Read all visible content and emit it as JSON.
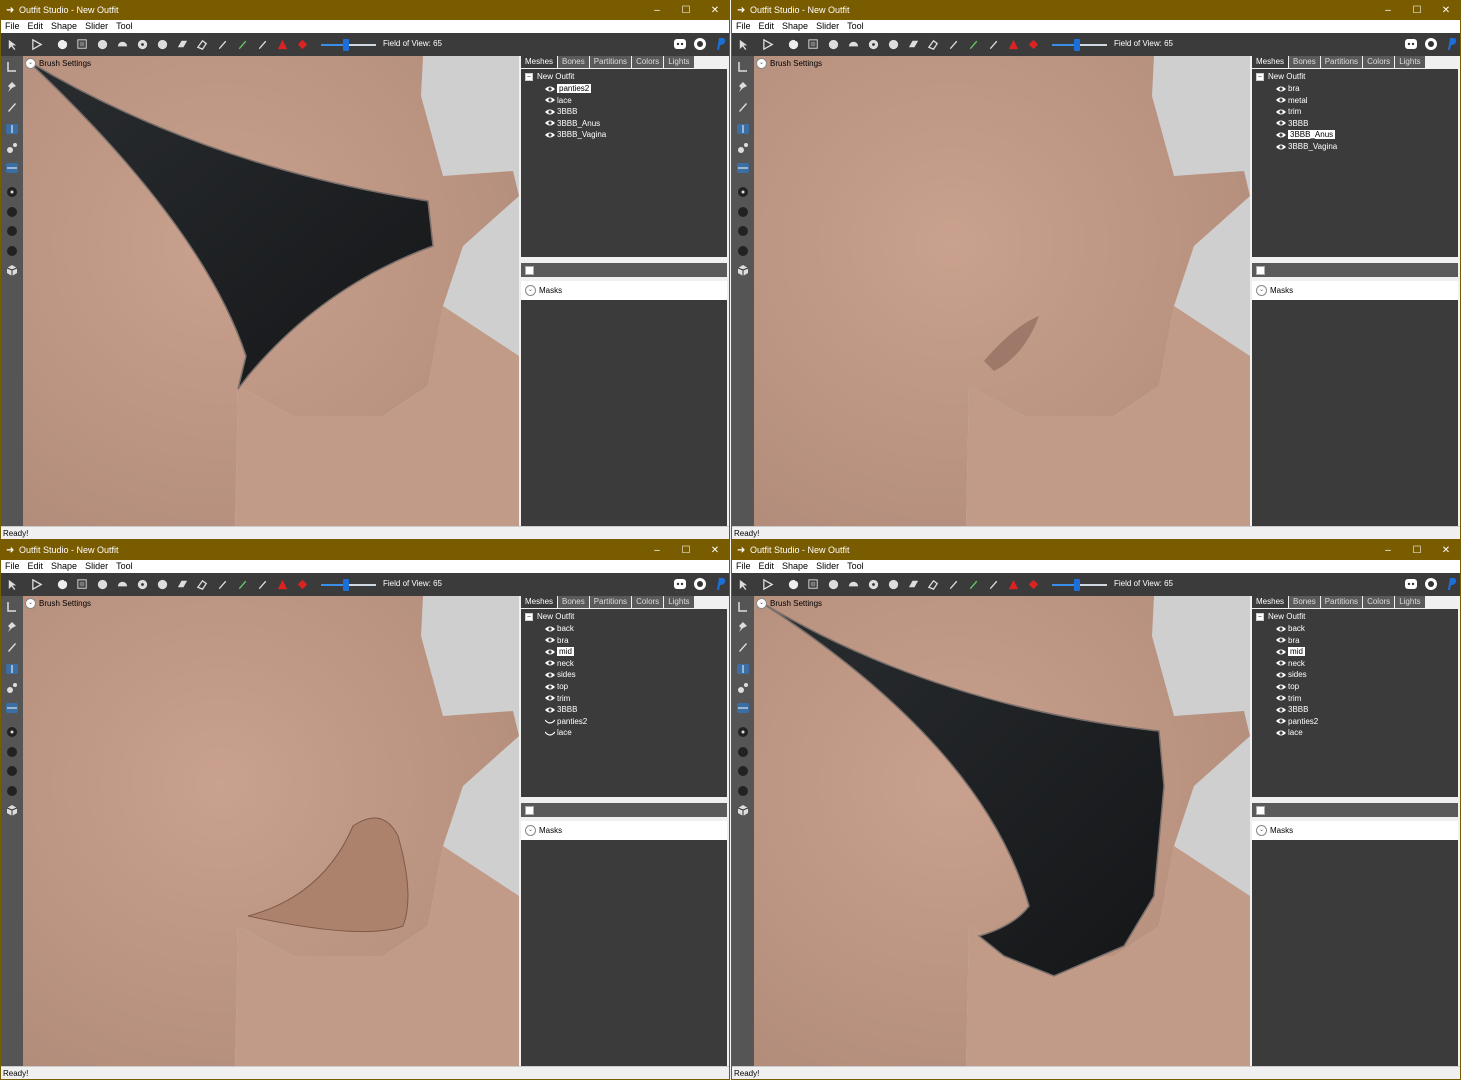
{
  "windows": [
    {
      "title": "Outfit Studio - New Outfit",
      "menu": [
        "File",
        "Edit",
        "Shape",
        "Slider",
        "Tool"
      ],
      "fov_label": "Field of View: 65",
      "fov_value": 65,
      "brush_settings": "Brush Settings",
      "tabs": [
        "Meshes",
        "Bones",
        "Partitions",
        "Colors",
        "Lights"
      ],
      "active_tab": 0,
      "tree_root": "New Outfit",
      "meshes": [
        {
          "name": "panties2",
          "visible": true,
          "selected": true
        },
        {
          "name": "lace",
          "visible": true,
          "selected": false
        },
        {
          "name": "3BBB",
          "visible": true,
          "selected": false
        },
        {
          "name": "3BBB_Anus",
          "visible": true,
          "selected": false
        },
        {
          "name": "3BBB_Vagina",
          "visible": true,
          "selected": false
        }
      ],
      "masks_label": "Masks",
      "status": "Ready!",
      "scene": "panties"
    },
    {
      "title": "Outfit Studio - New Outfit",
      "menu": [
        "File",
        "Edit",
        "Shape",
        "Slider",
        "Tool"
      ],
      "fov_label": "Field of View: 65",
      "fov_value": 65,
      "brush_settings": "Brush Settings",
      "tabs": [
        "Meshes",
        "Bones",
        "Partitions",
        "Colors",
        "Lights"
      ],
      "active_tab": 0,
      "tree_root": "New Outfit",
      "meshes": [
        {
          "name": "bra",
          "visible": true,
          "selected": false
        },
        {
          "name": "metal",
          "visible": true,
          "selected": false
        },
        {
          "name": "trim",
          "visible": true,
          "selected": false
        },
        {
          "name": "3BBB",
          "visible": true,
          "selected": false
        },
        {
          "name": "3BBB_Anus",
          "visible": true,
          "selected": true
        },
        {
          "name": "3BBB_Vagina",
          "visible": true,
          "selected": false
        }
      ],
      "masks_label": "Masks",
      "status": "Ready!",
      "scene": "nude"
    },
    {
      "title": "Outfit Studio - New Outfit",
      "menu": [
        "File",
        "Edit",
        "Shape",
        "Slider",
        "Tool"
      ],
      "fov_label": "Field of View: 65",
      "fov_value": 65,
      "brush_settings": "Brush Settings",
      "tabs": [
        "Meshes",
        "Bones",
        "Partitions",
        "Colors",
        "Lights"
      ],
      "active_tab": 0,
      "tree_root": "New Outfit",
      "meshes": [
        {
          "name": "back",
          "visible": true,
          "selected": false
        },
        {
          "name": "bra",
          "visible": true,
          "selected": false
        },
        {
          "name": "mid",
          "visible": true,
          "selected": true
        },
        {
          "name": "neck",
          "visible": true,
          "selected": false
        },
        {
          "name": "sides",
          "visible": true,
          "selected": false
        },
        {
          "name": "top",
          "visible": true,
          "selected": false
        },
        {
          "name": "trim",
          "visible": true,
          "selected": false
        },
        {
          "name": "3BBB",
          "visible": true,
          "selected": false
        },
        {
          "name": "panties2",
          "visible": false,
          "selected": false
        },
        {
          "name": "lace",
          "visible": false,
          "selected": false
        }
      ],
      "masks_label": "Masks",
      "status": "Ready!",
      "scene": "male"
    },
    {
      "title": "Outfit Studio - New Outfit",
      "menu": [
        "File",
        "Edit",
        "Shape",
        "Slider",
        "Tool"
      ],
      "fov_label": "Field of View: 65",
      "fov_value": 65,
      "brush_settings": "Brush Settings",
      "tabs": [
        "Meshes",
        "Bones",
        "Partitions",
        "Colors",
        "Lights"
      ],
      "active_tab": 0,
      "tree_root": "New Outfit",
      "meshes": [
        {
          "name": "back",
          "visible": true,
          "selected": false
        },
        {
          "name": "bra",
          "visible": true,
          "selected": false
        },
        {
          "name": "mid",
          "visible": true,
          "selected": true
        },
        {
          "name": "neck",
          "visible": true,
          "selected": false
        },
        {
          "name": "sides",
          "visible": true,
          "selected": false
        },
        {
          "name": "top",
          "visible": true,
          "selected": false
        },
        {
          "name": "trim",
          "visible": true,
          "selected": false
        },
        {
          "name": "3BBB",
          "visible": true,
          "selected": false
        },
        {
          "name": "panties2",
          "visible": true,
          "selected": false
        },
        {
          "name": "lace",
          "visible": true,
          "selected": false
        }
      ],
      "masks_label": "Masks",
      "status": "Ready!",
      "scene": "male-panties"
    }
  ],
  "colors": {
    "titlebar": "#7a5c00",
    "toolbar": "#3b3b3b",
    "panel": "#3b3b3b",
    "skin": "#c39a86",
    "fabric": "#1c1f21",
    "accent": "#1c6fd6"
  },
  "icons": {
    "toolbar": [
      "select-icon",
      "transform-icon",
      "brush-icon",
      "mask-icon",
      "inflate-icon",
      "deflate-icon",
      "move-icon",
      "smooth-icon",
      "undiff-icon",
      "eraser-icon",
      "pen-icon",
      "weight-icon",
      "color-icon",
      "alpha-icon",
      "collapse-icon",
      "expand-icon"
    ],
    "toolbar_right": [
      "discord-icon",
      "github-icon",
      "paypal-icon"
    ],
    "leftbar": [
      "l-tool-icon",
      "pin-icon",
      "pencil-icon",
      "mirror-x-icon",
      "mirror-y-icon",
      "mirror-z-icon",
      "dot-small-icon",
      "dot-large-icon",
      "dot-medium-icon",
      "dot-soft-icon",
      "cube-icon"
    ]
  }
}
